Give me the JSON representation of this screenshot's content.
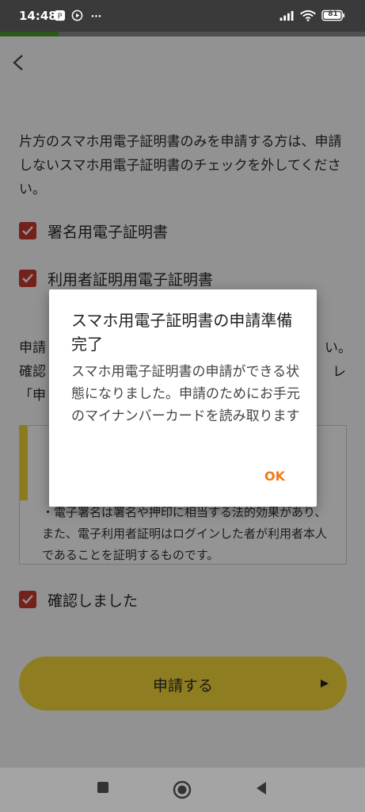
{
  "status_bar": {
    "time": "14:48",
    "icons": [
      "pay-icon",
      "play-icon",
      "more-dots"
    ],
    "right_icons": [
      "signal-icon",
      "wifi-icon",
      "battery-icon"
    ],
    "battery": "81"
  },
  "progress": {
    "percent": 16
  },
  "header": {
    "back_icon": "back-chevron-icon"
  },
  "content": {
    "intro": "片方のスマホ用電子証明書のみを申請する方は、申請しないスマホ用電子証明書のチェックを外してください。",
    "checkbox_sign": {
      "label": "署名用電子証明書",
      "checked": true
    },
    "checkbox_user": {
      "label": "利用者証明用電子証明書",
      "checked": true
    },
    "partial_line1": "申請",
    "partial_line1_end": "い。",
    "partial_line2": "確認",
    "partial_line2_end": "レ",
    "partial_line3": "「申",
    "note_text": "・電子署名は署名や押印に相当する法的効果があり、また、電子利用者証明はログインした者が利用者本人であることを証明するものです。",
    "confirm_checkbox": {
      "label": "確認しました",
      "checked": true
    },
    "submit_label": "申請する"
  },
  "dialog": {
    "title": "スマホ用電子証明書の申請準備完了",
    "message": "スマホ用電子証明書の申請ができる状態になりました。申請のためにお手元のマイナンバーカードを読み取ります",
    "ok_label": "OK"
  },
  "navbar": {
    "buttons": [
      "recents-square-icon",
      "home-circle-icon",
      "back-triangle-icon"
    ]
  },
  "colors": {
    "accent_red": "#c8392f",
    "button_yellow": "#f7d83a",
    "ok_orange": "#f07a16",
    "progress_green": "#4b9a2f"
  }
}
